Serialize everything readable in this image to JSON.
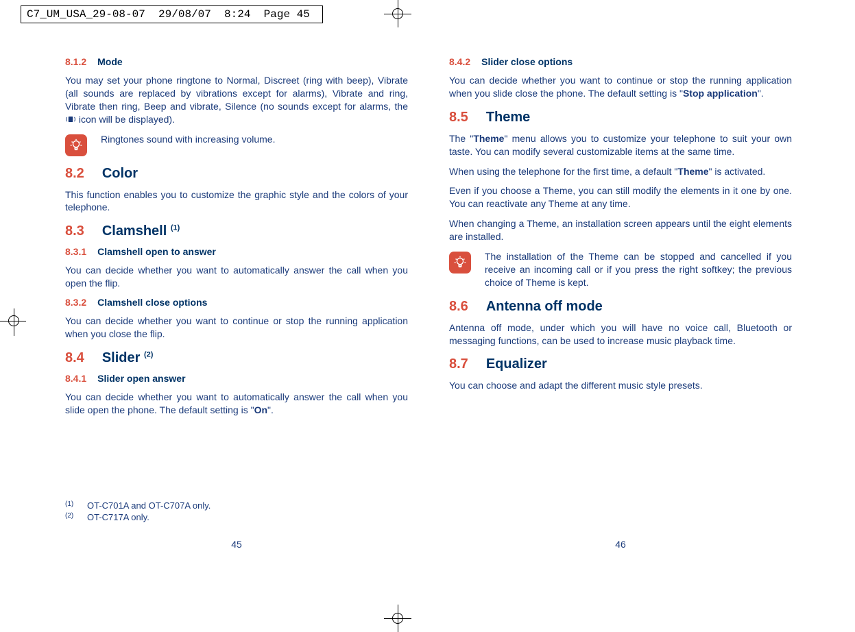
{
  "print_header": "C7_UM_USA_29-08-07  29/08/07  8:24  Page 45",
  "left": {
    "s812": {
      "num": "8.1.2",
      "title": "Mode",
      "body": "You may set your phone ringtone to Normal, Discreet (ring with beep), Vibrate (all sounds are replaced by vibrations except for alarms), Vibrate and ring, Vibrate then ring, Beep and vibrate, Silence (no sounds except for alarms, the ",
      "body_tail": " icon will be displayed)."
    },
    "note1": "Ringtones sound with increasing volume.",
    "s82": {
      "num": "8.2",
      "title": "Color",
      "body": "This function enables you to customize the graphic style and the colors of your telephone."
    },
    "s83": {
      "num": "8.3",
      "title": "Clamshell ",
      "sup": "(1)"
    },
    "s831": {
      "num": "8.3.1",
      "title": "Clamshell open to answer",
      "body": "You can decide whether you want to automatically answer the call when you open the flip."
    },
    "s832": {
      "num": "8.3.2",
      "title": "Clamshell close options",
      "body": "You can decide whether you want to continue or stop the running application when you close the flip."
    },
    "s84": {
      "num": "8.4",
      "title": "Slider ",
      "sup": "(2)"
    },
    "s841": {
      "num": "8.4.1",
      "title": "Slider open answer",
      "body_a": "You can decide whether you want to automatically answer the call when you slide open the phone. The default setting is \"",
      "on": "On",
      "body_b": "\"."
    },
    "footnotes": {
      "f1": {
        "num": "(1)",
        "text": "OT-C701A and OT-C707A only."
      },
      "f2": {
        "num": "(2)",
        "text": "OT-C717A only."
      }
    },
    "page_num": "45"
  },
  "right": {
    "s842": {
      "num": "8.4.2",
      "title": "Slider close options",
      "body_a": "You can decide whether you want to continue or stop the running application when you slide close the phone. The default setting is \"",
      "stop": "Stop application",
      "body_b": "\"."
    },
    "s85": {
      "num": "8.5",
      "title": "Theme",
      "p1_a": "The \"",
      "theme1": "Theme",
      "p1_b": "\" menu allows you to customize your telephone to suit your own taste.  You can modify several customizable items at the same time.",
      "p2_a": "When using the telephone for the first time, a default \"",
      "theme2": "Theme",
      "p2_b": "\" is activated.",
      "p3": "Even if you choose a Theme, you can still modify the elements in it one by one.  You can reactivate any Theme at any time.",
      "p4": "When changing a Theme, an installation screen appears until the eight elements are installed."
    },
    "note2": "The installation of the Theme can be stopped and cancelled if you receive an incoming call or if you press the right softkey; the previous choice of Theme is kept.",
    "s86": {
      "num": "8.6",
      "title": "Antenna off mode",
      "body": "Antenna off mode, under which you will have no voice call, Bluetooth or messaging functions, can be used to increase music playback time."
    },
    "s87": {
      "num": "8.7",
      "title": "Equalizer",
      "body": "You can choose and adapt the different music style presets."
    },
    "page_num": "46"
  }
}
